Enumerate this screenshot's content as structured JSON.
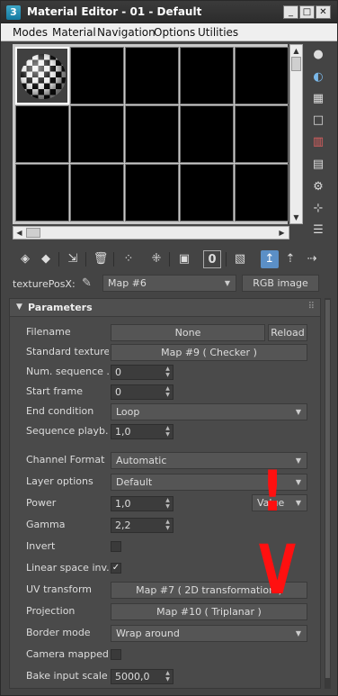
{
  "window": {
    "title": "Material Editor - 01 - Default",
    "icon_label": "3",
    "buttons": [
      "_",
      "□",
      "✕"
    ]
  },
  "menu": [
    "Modes",
    "Material",
    "Navigation",
    "Options",
    "Utilities"
  ],
  "slots": {
    "count": 15,
    "selected_index": 0,
    "selected_preview": "checker-sphere-icon"
  },
  "right_toolbar_icons": [
    "sample-type-sphere-icon",
    "backlight-icon",
    "background-checker-icon",
    "sample-uv-tiling-icon",
    "video-color-check-icon",
    "make-preview-icon",
    "options-icon",
    "select-by-material-icon",
    "material-map-navigator-icon"
  ],
  "toolbar_icons": [
    "get-material-icon",
    "put-to-scene-icon",
    "assign-to-selection-icon",
    "reset-map-icon",
    "make-unique-icon",
    "put-to-library-icon",
    "material-id-channel-icon",
    "show-shaded-in-viewport-icon",
    "show-end-result-icon",
    "go-to-parent-icon",
    "go-forward-to-sibling-icon"
  ],
  "name_row": {
    "label": "texturePosX:",
    "map_name": "Map #6",
    "type_button": "RGB image"
  },
  "parameters": {
    "header": "Parameters",
    "filename_label": "Filename",
    "filename_value": "None",
    "reload_label": "Reload",
    "standard_texture_label": "Standard texture",
    "standard_texture_value": "Map #9  ( Checker )",
    "num_sequence_label": "Num. sequence ...",
    "num_sequence_value": "0",
    "start_frame_label": "Start frame",
    "start_frame_value": "0",
    "end_condition_label": "End condition",
    "end_condition_value": "Loop",
    "sequence_playback_label": "Sequence playb...",
    "sequence_playback_value": "1,0",
    "channel_format_label": "Channel Format",
    "channel_format_value": "Automatic",
    "layer_options_label": "Layer options",
    "layer_options_value": "Default",
    "power_label": "Power",
    "power_value": "1,0",
    "power_mode_value": "Value",
    "gamma_label": "Gamma",
    "gamma_value": "2,2",
    "invert_label": "Invert",
    "invert_checked": false,
    "linear_space_label": "Linear space inv...",
    "linear_space_checked": true,
    "uv_transform_label": "UV transform",
    "uv_transform_value": "Map #7  ( 2D transformation )",
    "projection_label": "Projection",
    "projection_value": "Map #10  ( Triplanar )",
    "border_mode_label": "Border mode",
    "border_mode_value": "Wrap around",
    "camera_mapped_label": "Camera mapped",
    "camera_mapped_checked": false,
    "bake_input_scale_label": "Bake input scale",
    "bake_input_scale_value": "5000,0"
  },
  "annotation": {
    "exclamation": "!",
    "arrow": "V",
    "color": "#ff1010"
  }
}
